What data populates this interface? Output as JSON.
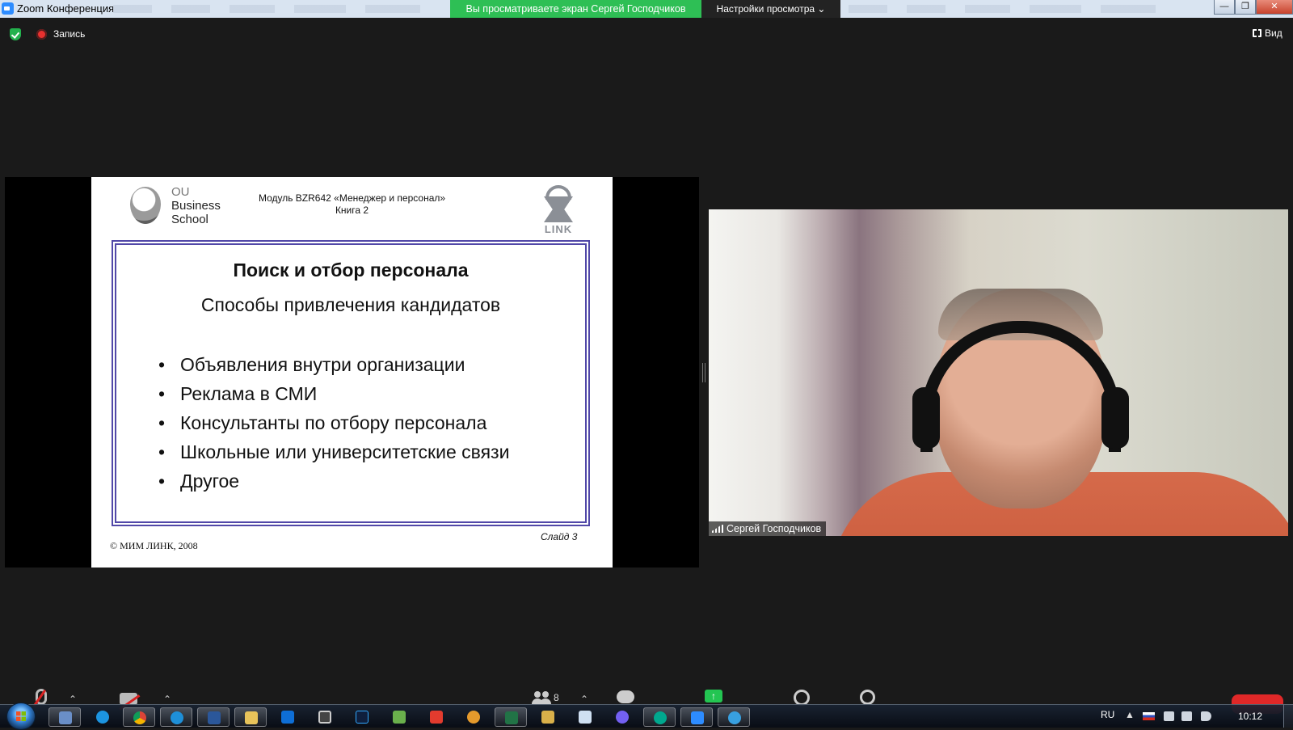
{
  "window": {
    "app_title": "Zoom Конференция",
    "share_banner": "Вы просматриваете экран Сергей Господчиков",
    "view_options": "Настройки просмотра ⌄",
    "controls": [
      "—",
      "❐",
      "✕"
    ]
  },
  "meeting_bar": {
    "recording_label": "Запись",
    "view_label": "Вид"
  },
  "slide": {
    "org_small": "OU",
    "org_line1": "Business",
    "org_line2": "School",
    "module_line1": "Модуль BZR642 «Менеджер и персонал»",
    "module_line2": "Книга 2",
    "partner_logo_text": "LINK",
    "title": "Поиск и отбор персонала",
    "subtitle": "Способы привлечения кандидатов",
    "bullets": [
      "Объявления внутри организации",
      "Реклама в СМИ",
      "Консультанты по отбору персонала",
      "Школьные или университетские связи",
      "Другое"
    ],
    "copyright": "© МИМ ЛИНК, 2008",
    "slide_number": "Слайд 3"
  },
  "participant": {
    "name": "Сергей Господчиков"
  },
  "meeting_controls": {
    "participants_count": "8"
  },
  "taskbar": {
    "apps": [
      "zoom-notes",
      "skype",
      "chrome",
      "internet-explorer",
      "word",
      "file-explorer",
      "teamviewer",
      "video-editor",
      "photoshop",
      "notepad-plus",
      "acrobat",
      "paint-app",
      "excel",
      "file-manager",
      "notepad",
      "viber",
      "kaspersky",
      "zoom",
      "edge-like"
    ],
    "language": "RU",
    "time": "10:12"
  },
  "colors": {
    "share_banner": "#2ebf55",
    "slide_frame": "#5148a8",
    "shirt": "#d56a4a",
    "end_button": "#e02828"
  }
}
